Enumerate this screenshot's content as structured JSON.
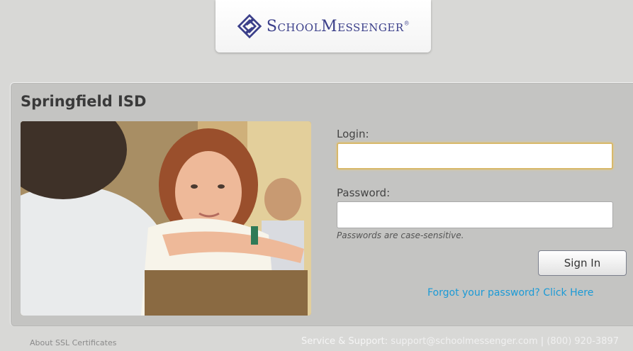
{
  "header": {
    "logo_text": "SchoolMessenger",
    "logo_mark": "®",
    "logo_icon": "schoolmessenger-diamond-logo"
  },
  "login_panel": {
    "org_name": "Springfield ISD",
    "photo_icon": "student-photo",
    "login_label": "Login:",
    "login_value": "",
    "password_label": "Password:",
    "password_value": "",
    "password_hint": "Passwords are case-sensitive.",
    "signin_label": "Sign In",
    "forgot_label": "Forgot your password? Click Here"
  },
  "footer": {
    "ssl_label": "About SSL Certificates",
    "support_label": "Service & Support:",
    "support_email": "support@schoolmessenger.com",
    "separator": "|",
    "support_phone": "(800) 920-3897"
  },
  "colors": {
    "link": "#1b9ad6",
    "logo": "#3b3f8a",
    "background": "#d8d8d6",
    "panel": "#c4c4c2"
  }
}
